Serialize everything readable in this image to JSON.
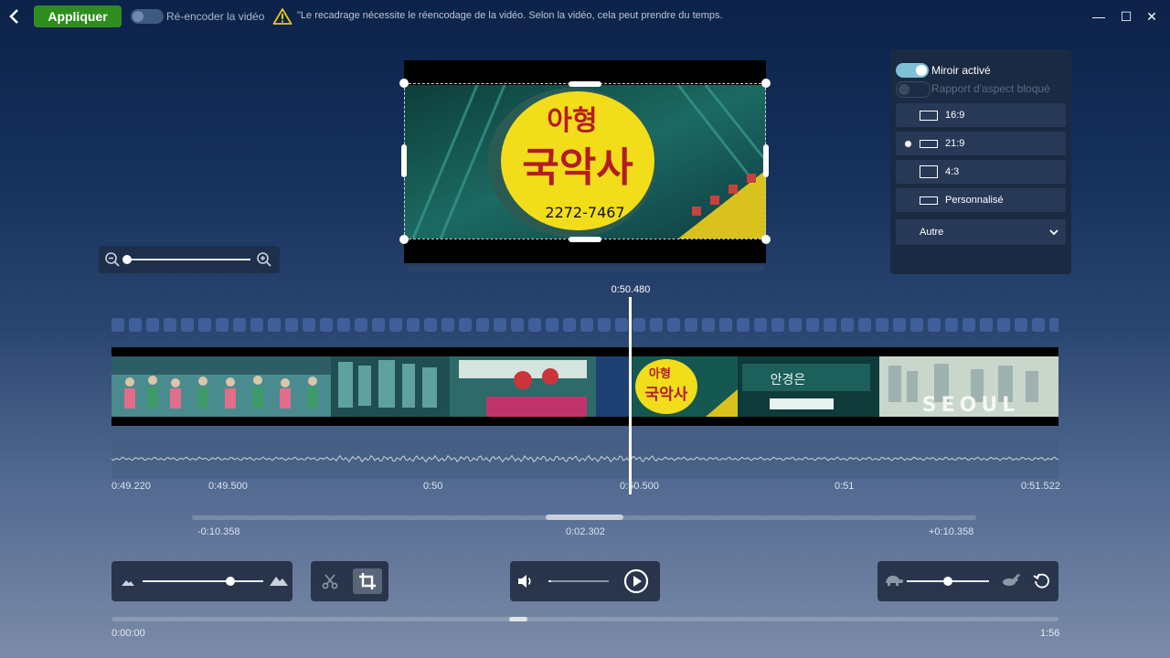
{
  "toolbar": {
    "apply_label": "Appliquer",
    "reencode_label": "Ré-encoder la vidéo",
    "warning_text": "\"Le recadrage nécessite le réencodage de la vidéo. Selon la vidéo, cela peut prendre du temps."
  },
  "window": {
    "minimize": "—",
    "maximize": "☐",
    "close": "✕"
  },
  "side_panel": {
    "mirror_label": "Miroir activé",
    "mirror_on": true,
    "aspect_lock_label": "Rapport d'aspect bloqué",
    "aspect_lock_on": false,
    "ratios": [
      {
        "label": "16:9",
        "selected": false
      },
      {
        "label": "21:9",
        "selected": true
      },
      {
        "label": "4:3",
        "selected": false
      },
      {
        "label": "Personnalisé",
        "selected": false
      }
    ],
    "other_select": "Autre"
  },
  "preview": {
    "sign_top": "아형",
    "sign_main": "국악사",
    "sign_phone": "2272-7467"
  },
  "timeline": {
    "playhead_time": "0:50.480",
    "ticks": [
      "0:49.220",
      "0:49.500",
      "0:50",
      "0:50.500",
      "0:51",
      "0:51.522"
    ],
    "range_left": "-0:10.358",
    "range_center": "0:02.302",
    "range_right": "+0:10.358",
    "thumb_texts": {
      "sign_top": "아형",
      "sign_main": "국악사",
      "shop": "안경은",
      "seoul": "SEOUL"
    }
  },
  "playback": {
    "current_time": "0:00:00",
    "duration": "1:56",
    "contrast_level": 0.73,
    "volume_level": 0.05,
    "speed_level": 0.5,
    "zoom_level": 0.0,
    "scrub_position": 0.42
  },
  "colors": {
    "accent_green": "#2f8d1f",
    "toggle_on": "#7ec0d6",
    "panel_bg": "#1b2a43"
  }
}
